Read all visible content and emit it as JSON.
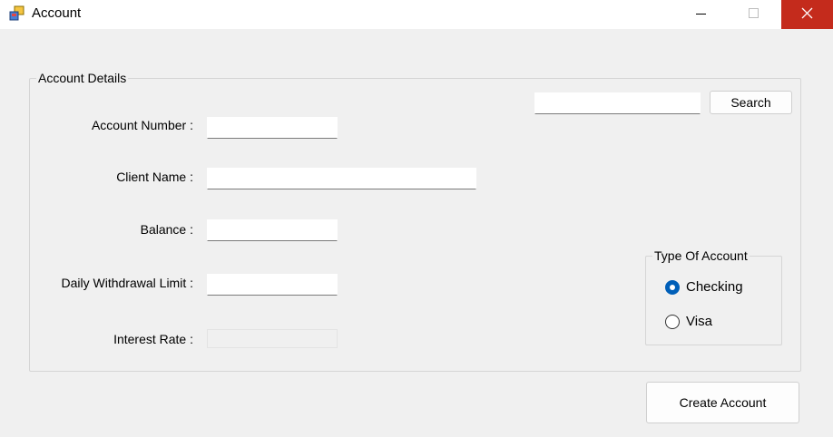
{
  "window": {
    "title": "Account"
  },
  "account_details": {
    "legend": "Account Details",
    "search": {
      "value": "",
      "button_label": "Search"
    },
    "fields": {
      "account_number": {
        "label": "Account Number :",
        "value": ""
      },
      "client_name": {
        "label": "Client Name :",
        "value": ""
      },
      "balance": {
        "label": "Balance :",
        "value": ""
      },
      "daily_withdrawal_limit": {
        "label": "Daily Withdrawal Limit :",
        "value": ""
      },
      "interest_rate": {
        "label": "Interest Rate :",
        "value": ""
      }
    },
    "type_of_account": {
      "legend": "Type Of Account",
      "options": [
        {
          "label": "Checking",
          "checked": true
        },
        {
          "label": "Visa",
          "checked": false
        }
      ]
    }
  },
  "actions": {
    "create_label": "Create Account"
  },
  "colors": {
    "close_button": "#c42b1c",
    "radio_accent": "#005fb8"
  }
}
